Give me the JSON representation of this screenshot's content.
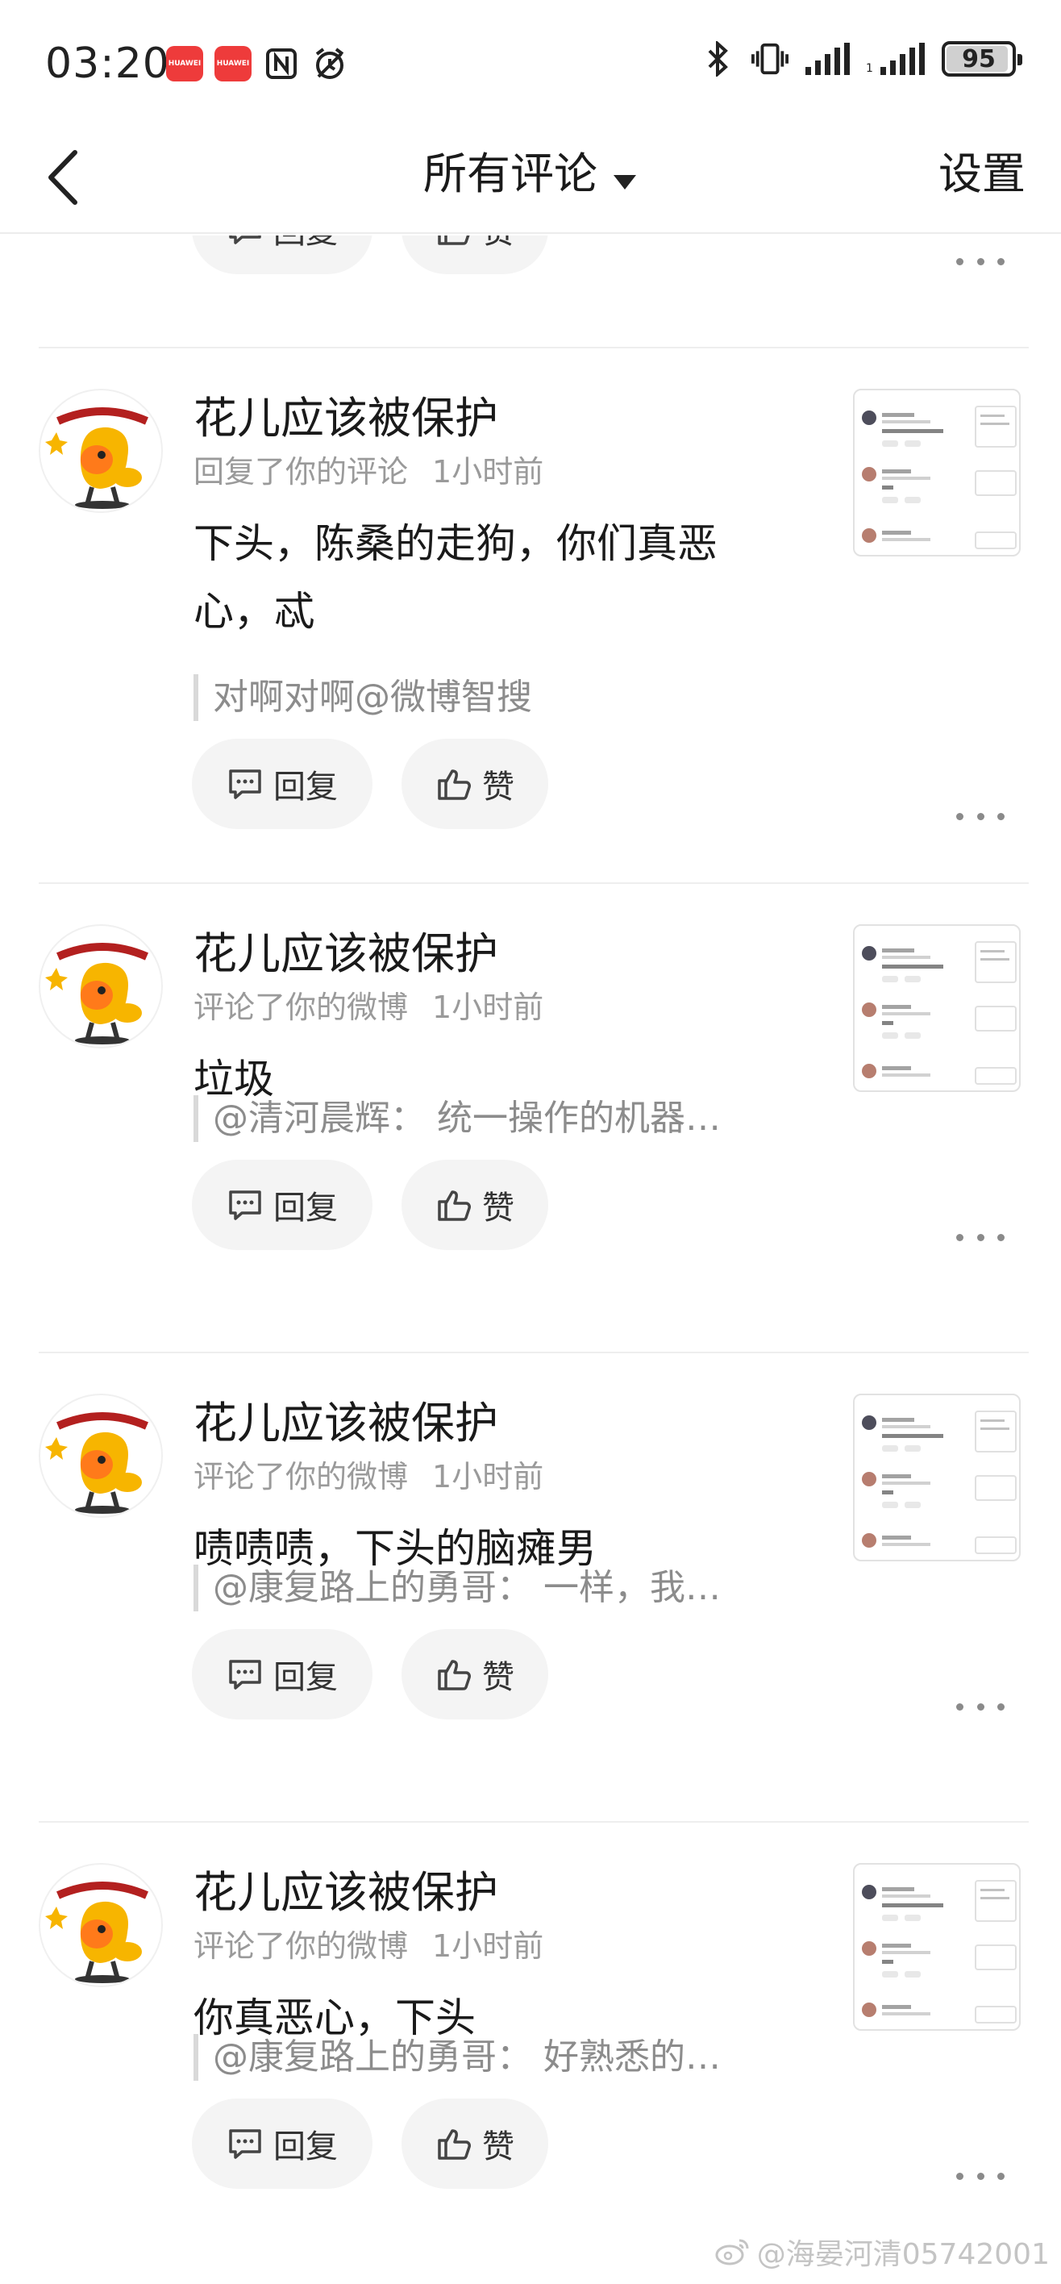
{
  "status_bar": {
    "time": "03:20",
    "app_badges": [
      "HUAWEI",
      "HUAWEI"
    ],
    "icons_left": [
      "nfc-icon",
      "alarm-icon"
    ],
    "icons_right": [
      "bluetooth-icon",
      "vibrate-icon",
      "signal-icon",
      "signal-icon"
    ],
    "battery": "95",
    "battery_level": 0.95
  },
  "nav": {
    "title": "所有评论",
    "settings": "设置"
  },
  "actions": {
    "reply": "回复",
    "like": "赞"
  },
  "comments": [
    {
      "username": "花儿应该被保护",
      "action": "回复了你的评论",
      "time": "1小时前",
      "content": "下头，陈桑的走狗，你们真恶心，忒",
      "quote": "对啊对啊@微博智搜"
    },
    {
      "username": "花儿应该被保护",
      "action": "评论了你的微博",
      "time": "1小时前",
      "content": "垃圾",
      "quote": "@清河晨辉：  统一操作的机器…"
    },
    {
      "username": "花儿应该被保护",
      "action": "评论了你的微博",
      "time": "1小时前",
      "content": "啧啧啧，下头的脑瘫男",
      "quote": "@康复路上的勇哥：  一样，我…"
    },
    {
      "username": "花儿应该被保护",
      "action": "评论了你的微博",
      "time": "1小时前",
      "content": "你真恶心，下头",
      "quote": "@康复路上的勇哥：  好熟悉的…"
    }
  ],
  "watermark": "@海晏河清05742001",
  "colors": {
    "pill_bg": "#f4f4f4",
    "meta": "#9a9a9a",
    "quote": "#8c8c8c",
    "badge": "#ee3b3b"
  }
}
